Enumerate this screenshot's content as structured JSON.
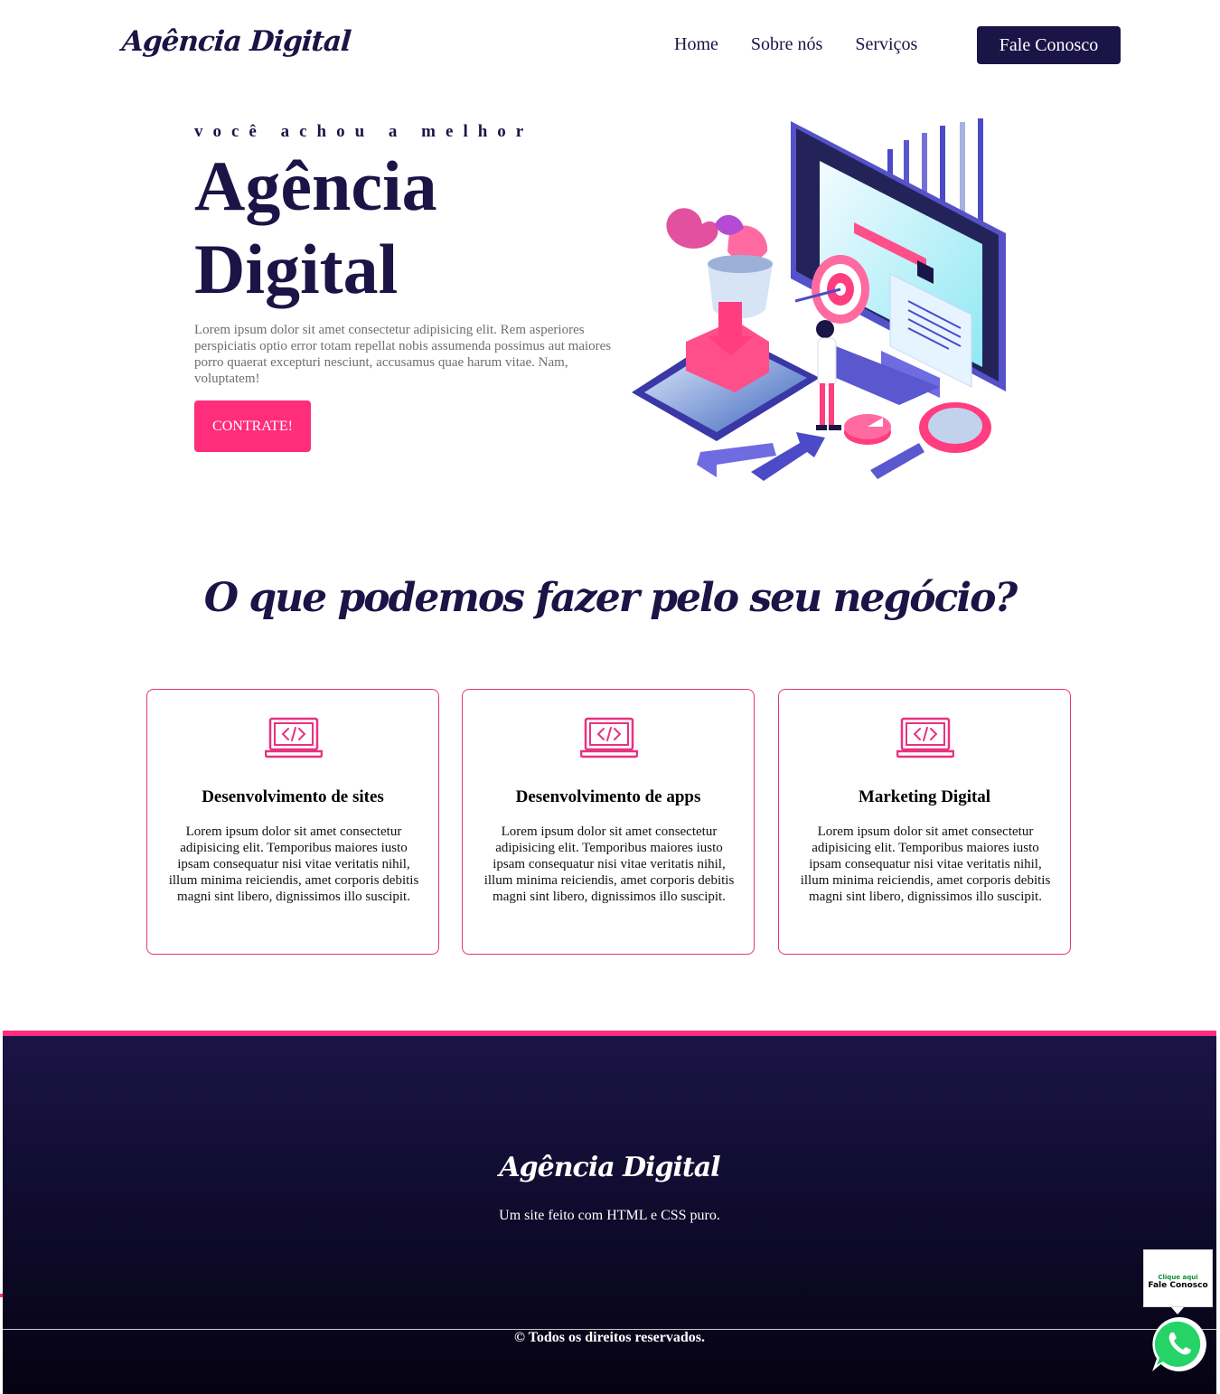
{
  "header": {
    "logo": "Agência Digital",
    "nav": [
      "Home",
      "Sobre nós",
      "Serviços"
    ],
    "cta": "Fale Conosco"
  },
  "hero": {
    "eyebrow": "você achou a melhor",
    "title": "Agência Digital",
    "text": "Lorem ipsum dolor sit amet consectetur adipisicing elit. Rem asperiores perspiciatis optio error totam repellat nobis assumenda possimus aut maiores porro quaerat excepturi nesciunt, accusamus quae harum vitae. Nam, voluptatem!",
    "button": "CONTRATE!"
  },
  "services": {
    "title": "O que podemos fazer pelo seu negócio?",
    "cards": [
      {
        "title": "Desenvolvimento de sites",
        "icon": "laptop-code-icon",
        "text": "Lorem ipsum dolor sit amet consectetur adipisicing elit. Temporibus maiores iusto ipsam consequatur nisi vitae veritatis nihil, illum minima reiciendis, amet corporis debitis magni sint libero, dignissimos illo suscipit."
      },
      {
        "title": "Desenvolvimento de apps",
        "icon": "laptop-code-icon",
        "text": "Lorem ipsum dolor sit amet consectetur adipisicing elit. Temporibus maiores iusto ipsam consequatur nisi vitae veritatis nihil, illum minima reiciendis, amet corporis debitis magni sint libero, dignissimos illo suscipit."
      },
      {
        "title": "Marketing Digital",
        "icon": "laptop-code-icon",
        "text": "Lorem ipsum dolor sit amet consectetur adipisicing elit. Temporibus maiores iusto ipsam consequatur nisi vitae veritatis nihil, illum minima reiciendis, amet corporis debitis magni sint libero, dignissimos illo suscipit."
      }
    ]
  },
  "footer": {
    "logo": "Agência Digital",
    "subtitle": "Um site feito com HTML e CSS puro.",
    "copyright": "© Todos os direitos reservados."
  },
  "whatsapp": {
    "line1": "Clique aqui",
    "line2": "Fale Conosco",
    "icon": "whatsapp-icon"
  },
  "colors": {
    "navy": "#1b1446",
    "pink": "#ff2d7b",
    "white": "#ffffff",
    "whatsapp_green": "#25d366"
  }
}
